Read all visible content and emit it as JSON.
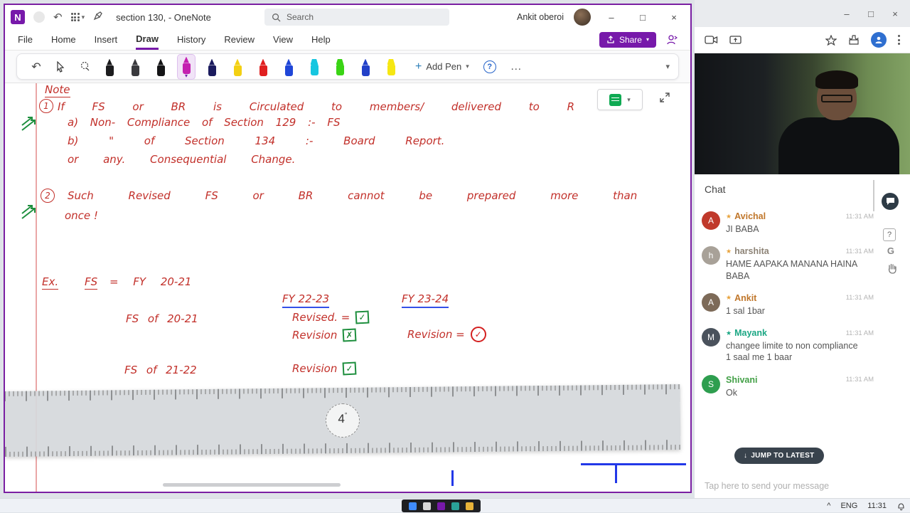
{
  "icons": {
    "undo": "↶",
    "dropdown": "▾",
    "minimize": "–",
    "maximize": "□",
    "close": "×",
    "more": "…",
    "help": "?",
    "add": "+",
    "down_arrow": "↓",
    "star": "★",
    "tray_expand": "^",
    "logo_letter": "N"
  },
  "onenote": {
    "titlebar": {
      "title": "section 130,  - OneNote",
      "search_placeholder": "Search",
      "user_name": "Ankit oberoi"
    },
    "menu": {
      "items": [
        "File",
        "Home",
        "Insert",
        "Draw",
        "History",
        "Review",
        "View",
        "Help"
      ]
    },
    "share_label": "Share",
    "toolbar": {
      "add_pen_label": "Add Pen",
      "pens": [
        {
          "name": "pen-black",
          "color": "#1c1c1e"
        },
        {
          "name": "pen-dark-gray",
          "color": "#3a3a3e"
        },
        {
          "name": "pen-black-2",
          "color": "#141416"
        },
        {
          "name": "pen-magenta",
          "color": "#c41fb0"
        },
        {
          "name": "pen-navy",
          "color": "#1b1b5e"
        },
        {
          "name": "pen-yellow",
          "color": "#f3d013"
        },
        {
          "name": "pen-red",
          "color": "#e02020"
        },
        {
          "name": "pen-blue",
          "color": "#1f46d8"
        },
        {
          "name": "highlighter-cyan",
          "color": "#17c6e0"
        },
        {
          "name": "highlighter-green",
          "color": "#3ad415"
        },
        {
          "name": "pen-blue-2",
          "color": "#2240c8"
        },
        {
          "name": "highlighter-yellow",
          "color": "#f6e713"
        }
      ]
    },
    "canvas": {
      "note_heading": "Note",
      "item1_number": "1",
      "line1": "If FS or BR is Circulated to members/ delivered to R",
      "line1a": "a) Non- Compliance of Section 129 :- FS",
      "line1b": "b) \" of Section 134 :- Board Report.",
      "line1c": "or any. Consequential Change.",
      "item2_number": "2",
      "line2": "Such Revised FS or BR cannot be prepared more than",
      "line2b": "once !",
      "ex_label": "Ex.",
      "ex_fs": "FS",
      "ex_rest": "= FY 20-21",
      "fy_col1": "FY 22-23",
      "fy_col2": "FY 23-24",
      "fs_2021": "FS of 20-21",
      "revised_label": "Revised. =",
      "revision_label": "Revision",
      "revision_eq_label": "Revision =",
      "fs_2122": "FS of 21-22",
      "revision2_label": "Revision",
      "check": "✓",
      "cross": "✗",
      "ruler_angle": "4",
      "ruler_degree": "°"
    }
  },
  "chat": {
    "header": "Chat",
    "messages": [
      {
        "name": "Avichal",
        "initial": "A",
        "time": "11:31 AM",
        "text": "JI BABA",
        "name_color": "#c0762a",
        "avatar_color": "#c0392b",
        "star_color": "#e8a33d"
      },
      {
        "name": "harshita",
        "initial": "h",
        "time": "11:31 AM",
        "text": "HAME AAPAKA MANANA HAINA BABA",
        "name_color": "#8d8376",
        "avatar_color": "#a8a198",
        "star_color": "#e8a33d"
      },
      {
        "name": "Ankit",
        "initial": "A",
        "time": "11:31 AM",
        "text": "1 sal 1bar",
        "name_color": "#c0762a",
        "avatar_color": "#7d6a58",
        "star_color": "#e8a33d"
      },
      {
        "name": "Mayank",
        "initial": "M",
        "time": "11:31 AM",
        "text": "changee limite to non compliance\n1 saal me 1 baar",
        "name_color": "#1ba784",
        "avatar_color": "#4a525c",
        "star_color": "#1ba784"
      },
      {
        "name": "Shivani",
        "initial": "S",
        "time": "11:31 AM",
        "text": "Ok",
        "name_color": "#43a047",
        "avatar_color": "#2e9e4f",
        "star_color": "#43a047"
      }
    ],
    "jump_button": "JUMP TO LATEST",
    "gif_label": "G",
    "input_placeholder": "Tap here to send your message"
  },
  "taskbar": {
    "lang": "ENG",
    "time": "11:31"
  }
}
